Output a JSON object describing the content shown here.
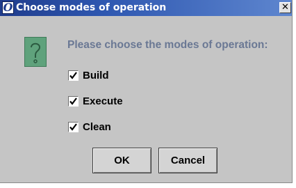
{
  "window": {
    "title": "Choose modes of operation",
    "logo_glyph": "O",
    "close_glyph": "✕"
  },
  "dialog": {
    "icon": "question-icon",
    "prompt": "Please choose the modes of operation:",
    "options": [
      {
        "label": "Build",
        "checked": true
      },
      {
        "label": "Execute",
        "checked": true
      },
      {
        "label": "Clean",
        "checked": true
      }
    ]
  },
  "buttons": {
    "ok_label": "OK",
    "cancel_label": "Cancel"
  },
  "colors": {
    "dialog_bg": "#c5c5c5",
    "titlebar": "#2e57b0",
    "prompt_text": "#6a7894",
    "icon_bg": "#5fa27c"
  }
}
